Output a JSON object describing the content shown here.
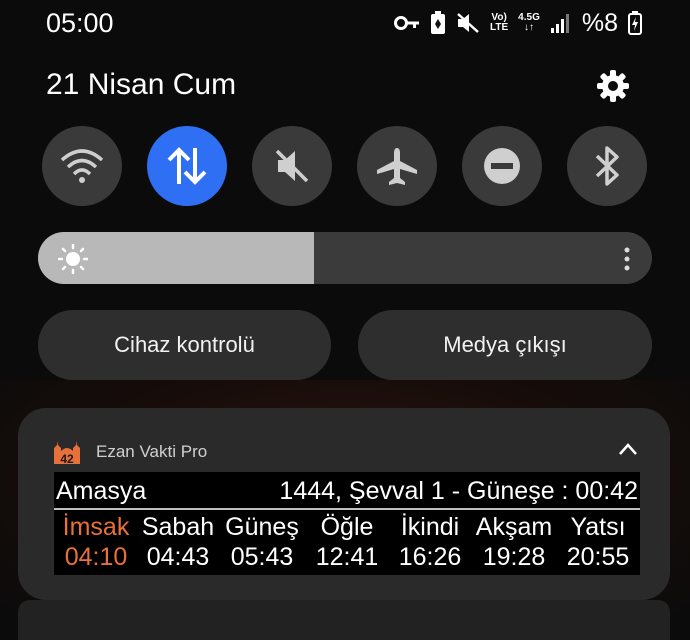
{
  "status_bar": {
    "time": "05:00",
    "net_top": "4.5G",
    "volte_top": "Vo)",
    "volte_bottom": "LTE",
    "battery": "%8",
    "icons": [
      "key-icon",
      "battery-saver-icon",
      "mute-icon",
      "volte-icon",
      "network-4-5g-icon",
      "signal-icon",
      "battery-icon"
    ]
  },
  "header": {
    "date": "21 Nisan Cum",
    "settings_icon": "gear-icon"
  },
  "quick_tiles": [
    {
      "name": "wifi",
      "icon": "wifi-icon",
      "active": false
    },
    {
      "name": "mobile-data",
      "icon": "data-arrows-icon",
      "active": true
    },
    {
      "name": "sound",
      "icon": "mute-icon",
      "active": false
    },
    {
      "name": "airplane",
      "icon": "airplane-icon",
      "active": false
    },
    {
      "name": "do-not-disturb",
      "icon": "dnd-icon",
      "active": false
    },
    {
      "name": "bluetooth",
      "icon": "bluetooth-icon",
      "active": false
    }
  ],
  "brightness": {
    "level": 0.45,
    "icon": "sun-icon",
    "fill_color": "#b8b8b8"
  },
  "buttons": {
    "device_control": "Cihaz kontrolü",
    "media_output": "Medya çıkışı"
  },
  "notification": {
    "app_name": "Ezan Vakti Pro",
    "app_icon_number": "42",
    "city": "Amasya",
    "hijri_line": "1444, Şevval 1 - Güneşe : 00:42",
    "prayers": [
      {
        "name": "İmsak",
        "time": "04:10"
      },
      {
        "name": "Sabah",
        "time": "04:43"
      },
      {
        "name": "Güneş",
        "time": "05:43"
      },
      {
        "name": "Öğle",
        "time": "12:41"
      },
      {
        "name": "İkindi",
        "time": "16:26"
      },
      {
        "name": "Akşam",
        "time": "19:28"
      },
      {
        "name": "Yatsı",
        "time": "20:55"
      }
    ],
    "highlight_color": "#e8703a"
  },
  "colors": {
    "accent": "#2f6ff3",
    "tile_bg": "#3a3a3a",
    "card_bg": "#2a2a2a"
  }
}
